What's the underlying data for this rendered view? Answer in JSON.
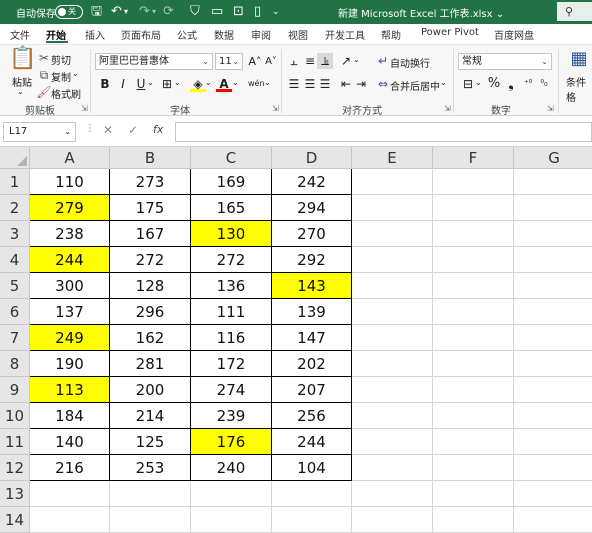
{
  "titlebar": {
    "autosave_label": "自动保存",
    "autosave_state": "关",
    "doc_title": "新建 Microsoft Excel 工作表.xlsx",
    "title_caret": "⌄",
    "search_glyph": "⚲"
  },
  "tabs": [
    "文件",
    "开始",
    "插入",
    "页面布局",
    "公式",
    "数据",
    "审阅",
    "视图",
    "开发工具",
    "帮助",
    "Power Pivot",
    "百度网盘"
  ],
  "active_tab": "开始",
  "ribbon": {
    "clipboard": {
      "paste": "粘贴",
      "cut": "剪切",
      "copy": "复制",
      "format_painter": "格式刷",
      "group_label": "剪贴板"
    },
    "font": {
      "font_name": "阿里巴巴普惠体",
      "font_size": "11",
      "bold": "B",
      "italic": "I",
      "underline": "U",
      "group_label": "字体"
    },
    "alignment": {
      "wrap_text": "自动换行",
      "merge_center": "合并后居中",
      "group_label": "对齐方式"
    },
    "number": {
      "format": "常规",
      "percent": "%",
      "group_label": "数字"
    },
    "styles": {
      "conditional_format": "条件格"
    }
  },
  "formula_bar": {
    "name_box": "L17",
    "fx": "fx",
    "formula": ""
  },
  "sheet": {
    "columns": [
      "A",
      "B",
      "C",
      "D",
      "E",
      "F",
      "G"
    ],
    "row_numbers": [
      "1",
      "2",
      "3",
      "4",
      "5",
      "6",
      "7",
      "8",
      "9",
      "10",
      "11",
      "12",
      "13",
      "14"
    ],
    "highlight_color": "#ffff00",
    "rows": [
      [
        "110",
        "273",
        "169",
        "242"
      ],
      [
        "279",
        "175",
        "165",
        "294"
      ],
      [
        "238",
        "167",
        "130",
        "270"
      ],
      [
        "244",
        "272",
        "272",
        "292"
      ],
      [
        "300",
        "128",
        "136",
        "143"
      ],
      [
        "137",
        "296",
        "111",
        "139"
      ],
      [
        "249",
        "162",
        "116",
        "147"
      ],
      [
        "190",
        "281",
        "172",
        "202"
      ],
      [
        "113",
        "200",
        "274",
        "207"
      ],
      [
        "184",
        "214",
        "239",
        "256"
      ],
      [
        "140",
        "125",
        "176",
        "244"
      ],
      [
        "216",
        "253",
        "240",
        "104"
      ]
    ],
    "highlighted_cells": [
      "A2",
      "A4",
      "A7",
      "A9",
      "C3",
      "C11",
      "D5"
    ]
  },
  "colors": {
    "excel_green": "#217346",
    "highlight": "#ffff00"
  }
}
